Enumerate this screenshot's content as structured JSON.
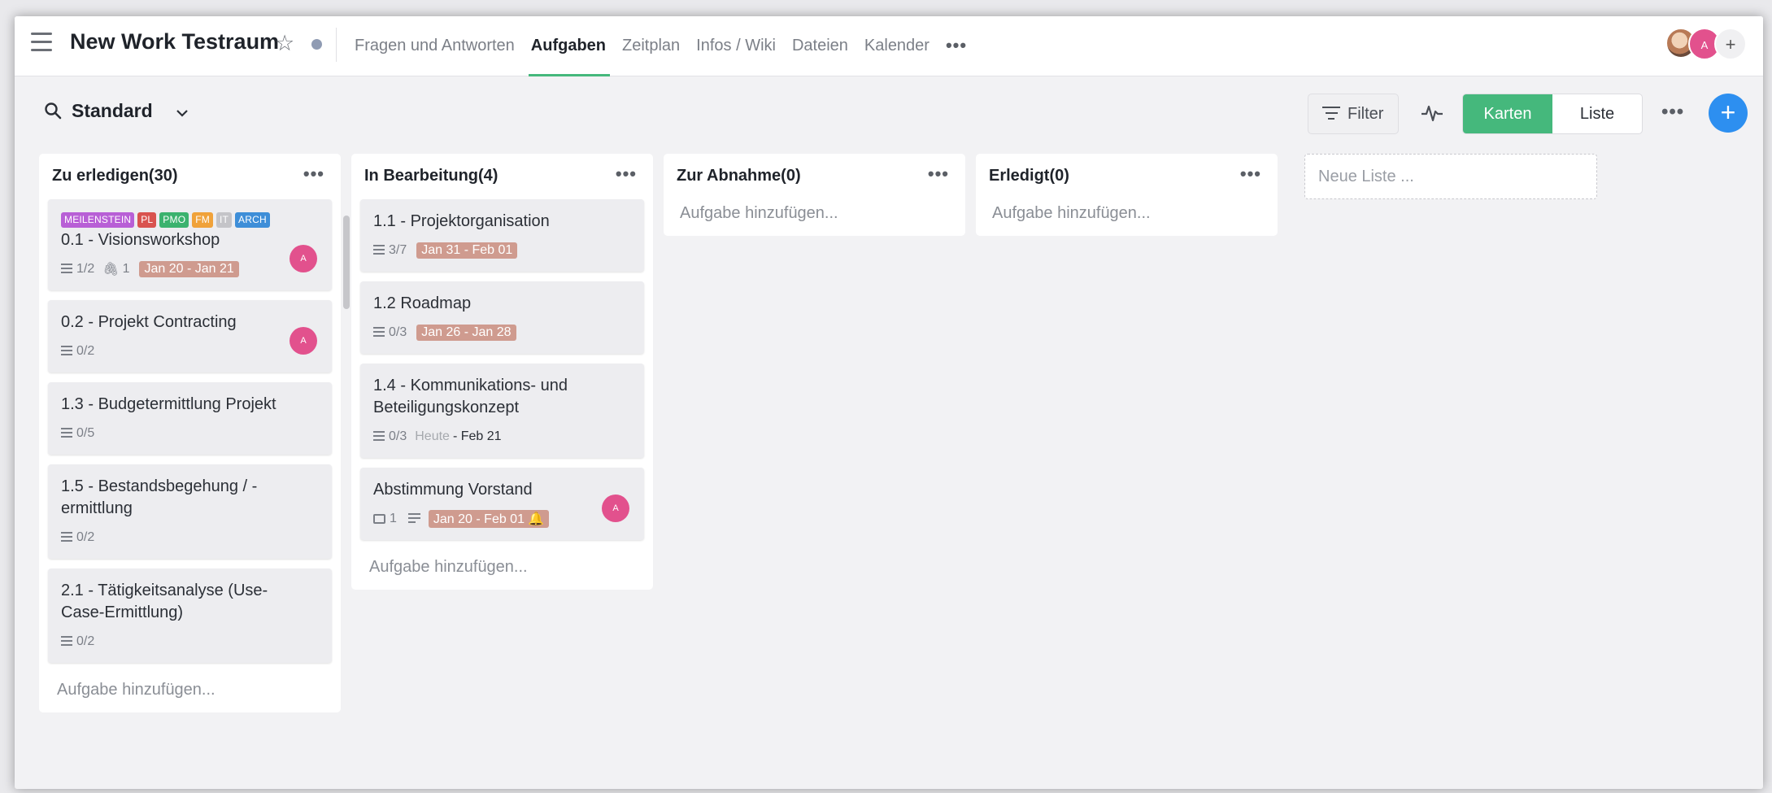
{
  "header": {
    "space_title": "New Work Testraum",
    "tabs": [
      {
        "label": "Fragen und Antworten",
        "active": false
      },
      {
        "label": "Aufgaben",
        "active": true
      },
      {
        "label": "Zeitplan",
        "active": false
      },
      {
        "label": "Infos / Wiki",
        "active": false
      },
      {
        "label": "Dateien",
        "active": false
      },
      {
        "label": "Kalender",
        "active": false
      }
    ],
    "more": "•••",
    "avatar_letter": "A",
    "add": "+"
  },
  "toolbar": {
    "view_name": "Standard",
    "filter_label": "Filter",
    "view_toggle": {
      "cards": "Karten",
      "list": "Liste"
    },
    "more": "•••",
    "add": "+"
  },
  "colors": {
    "accent_green": "#45b87c",
    "accent_blue": "#2d8ff0",
    "date_badge": "#cf9b8f",
    "avatar_pink": "#e2518d"
  },
  "columns": [
    {
      "title": "Zu erledigen(30)",
      "add_task": "Aufgabe hinzufügen...",
      "cards": [
        {
          "tags": [
            {
              "label": "MEILENSTEIN",
              "color": "#b85fd6"
            },
            {
              "label": "PL",
              "color": "#d9534f"
            },
            {
              "label": "PMO",
              "color": "#3bb26e"
            },
            {
              "label": "FM",
              "color": "#f0a23a"
            },
            {
              "label": "IT",
              "color": "#c4c4c8"
            },
            {
              "label": "ARCH",
              "color": "#3e8ed8"
            }
          ],
          "title": "0.1 - Visionsworkshop",
          "checklist": "1/2",
          "attachments": "1",
          "date": "Jan 20 - Jan 21",
          "avatar": "A"
        },
        {
          "title": "0.2 - Projekt Contracting",
          "checklist": "0/2",
          "avatar": "A"
        },
        {
          "title": "1.3 - Budgetermittlung Projekt",
          "checklist": "0/5"
        },
        {
          "title": "1.5 - Bestandsbegehung / -ermittlung",
          "checklist": "0/2"
        },
        {
          "title": "2.1 - Tätigkeitsanalyse (Use-Case-Ermittlung)",
          "checklist": "0/2"
        }
      ]
    },
    {
      "title": "In Bearbeitung(4)",
      "add_task": "Aufgabe hinzufügen...",
      "cards": [
        {
          "title": "1.1 - Projektorganisation",
          "checklist": "3/7",
          "date": "Jan 31 - Feb 01"
        },
        {
          "title": "1.2 Roadmap",
          "checklist": "0/3",
          "date": "Jan 26 - Jan 28"
        },
        {
          "title": "1.4 - Kommunikations- und Beteiligungskonzept",
          "checklist": "0/3",
          "date_start": "Heute",
          "date_end": "- Feb 21"
        },
        {
          "title": "Abstimmung Vorstand",
          "comments": "1",
          "date": "Jan 20 - Feb 01",
          "bell": "🔔",
          "avatar": "A"
        }
      ]
    },
    {
      "title": "Zur Abnahme(0)",
      "add_task": "Aufgabe hinzufügen..."
    },
    {
      "title": "Erledigt(0)",
      "add_task": "Aufgabe hinzufügen..."
    }
  ],
  "new_list_placeholder": "Neue Liste ..."
}
